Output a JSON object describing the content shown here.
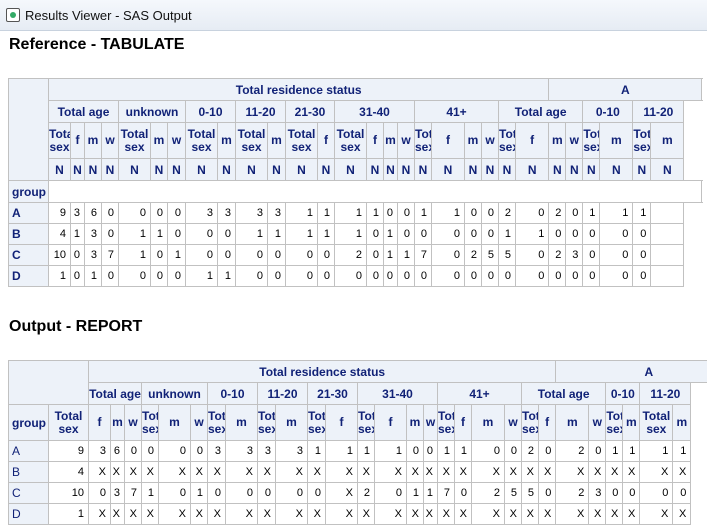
{
  "window": {
    "title": "Results Viewer - SAS Output",
    "icon": "sas-output-icon"
  },
  "sections": [
    {
      "title": "Reference - TABULATE",
      "row_header_label": "group",
      "top_header": "Total residence status",
      "top_header2": "A",
      "groups": [
        "Total age",
        "unknown",
        "0-10",
        "11-20",
        "21-30",
        "31-40",
        "41+",
        "Total age",
        "0-10",
        "11-20"
      ],
      "subcols": [
        "Total sex",
        "f",
        "m",
        "w",
        "Total sex",
        "m",
        "w",
        "Total sex",
        "m",
        "Total sex",
        "m",
        "Total sex",
        "f",
        "Total sex",
        "f",
        "m",
        "w",
        "Total sex",
        "f",
        "m",
        "w",
        "Total sex",
        "f",
        "m",
        "w",
        "Total sex",
        "m",
        "Total sex",
        "m"
      ],
      "stats": [
        "N",
        "N",
        "N",
        "N",
        "N",
        "N",
        "N",
        "N",
        "N",
        "N",
        "N",
        "N",
        "N",
        "N",
        "N",
        "N",
        "N",
        "N",
        "N",
        "N",
        "N",
        "N",
        "N",
        "N",
        "N",
        "N",
        "N",
        "N",
        "N"
      ],
      "rows": [
        {
          "label": "A",
          "cells": [
            "9",
            "3",
            "6",
            "0",
            "0",
            "0",
            "0",
            "3",
            "3",
            "3",
            "3",
            "1",
            "1",
            "1",
            "1",
            "0",
            "0",
            "1",
            "1",
            "0",
            "0",
            "2",
            "0",
            "2",
            "0",
            "1",
            "1",
            "1",
            ""
          ]
        },
        {
          "label": "B",
          "cells": [
            "4",
            "1",
            "3",
            "0",
            "1",
            "1",
            "0",
            "0",
            "0",
            "1",
            "1",
            "1",
            "1",
            "1",
            "0",
            "1",
            "0",
            "0",
            "0",
            "0",
            "0",
            "1",
            "1",
            "0",
            "0",
            "0",
            "0",
            "0",
            ""
          ]
        },
        {
          "label": "C",
          "cells": [
            "10",
            "0",
            "3",
            "7",
            "1",
            "0",
            "1",
            "0",
            "0",
            "0",
            "0",
            "0",
            "0",
            "2",
            "0",
            "1",
            "1",
            "7",
            "0",
            "2",
            "5",
            "5",
            "0",
            "2",
            "3",
            "0",
            "0",
            "0",
            ""
          ]
        },
        {
          "label": "D",
          "cells": [
            "1",
            "0",
            "1",
            "0",
            "0",
            "0",
            "0",
            "1",
            "1",
            "0",
            "0",
            "0",
            "0",
            "0",
            "0",
            "0",
            "0",
            "0",
            "0",
            "0",
            "0",
            "0",
            "0",
            "0",
            "0",
            "0",
            "0",
            "0",
            ""
          ]
        }
      ]
    },
    {
      "title": "Output - REPORT",
      "row_header_label": "group",
      "top_header": "Total residence status",
      "top_header2": "A",
      "groups": [
        "Total age",
        "unknown",
        "0-10",
        "11-20",
        "21-30",
        "31-40",
        "41+",
        "Total age",
        "0-10",
        "11-20"
      ],
      "subcols": [
        "Total sex",
        "f",
        "m",
        "w",
        "Total sex",
        "m",
        "w",
        "Total sex",
        "m",
        "Total sex",
        "m",
        "Total sex",
        "f",
        "Total sex",
        "f",
        "m",
        "w",
        "Total sex",
        "f",
        "m",
        "w",
        "Total sex",
        "f",
        "m",
        "w",
        "Total sex",
        "m",
        "Total sex",
        "m"
      ],
      "rows": [
        {
          "label": "A",
          "cells": [
            "9",
            "3",
            "6",
            "0",
            "0",
            "0",
            "0",
            "3",
            "3",
            "3",
            "3",
            "1",
            "1",
            "1",
            "1",
            "0",
            "0",
            "1",
            "1",
            "0",
            "0",
            "2",
            "0",
            "2",
            "0",
            "1",
            "1",
            "1",
            "1"
          ]
        },
        {
          "label": "B",
          "cells": [
            "4",
            "X",
            "X",
            "X",
            "X",
            "X",
            "X",
            "X",
            "X",
            "X",
            "X",
            "X",
            "X",
            "X",
            "X",
            "X",
            "X",
            "X",
            "X",
            "X",
            "X",
            "X",
            "X",
            "X",
            "X",
            "X",
            "X",
            "X",
            "X"
          ]
        },
        {
          "label": "C",
          "cells": [
            "10",
            "0",
            "3",
            "7",
            "1",
            "0",
            "1",
            "0",
            "0",
            "0",
            "0",
            "0",
            "X",
            "2",
            "0",
            "1",
            "1",
            "7",
            "0",
            "2",
            "5",
            "5",
            "0",
            "2",
            "3",
            "0",
            "0",
            "0",
            "0"
          ]
        },
        {
          "label": "D",
          "cells": [
            "1",
            "X",
            "X",
            "X",
            "X",
            "X",
            "X",
            "X",
            "X",
            "X",
            "X",
            "X",
            "X",
            "X",
            "X",
            "X",
            "X",
            "X",
            "X",
            "X",
            "X",
            "X",
            "X",
            "X",
            "X",
            "X",
            "X",
            "X",
            "X"
          ]
        }
      ]
    }
  ]
}
